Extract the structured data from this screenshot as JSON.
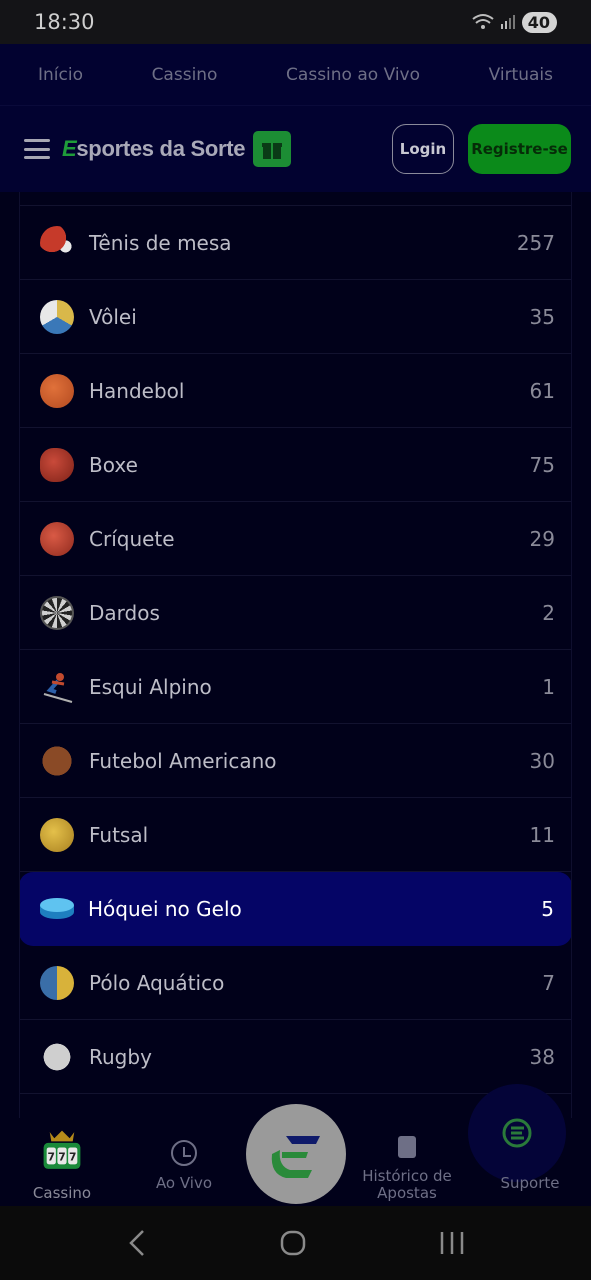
{
  "status_bar": {
    "time": "18:30",
    "battery": "40",
    "icons": [
      "wifi-icon",
      "signal-icon",
      "battery-icon"
    ]
  },
  "top_nav": {
    "items": [
      {
        "label": "Início"
      },
      {
        "label": "Cassino"
      },
      {
        "label": "Cassino ao Vivo"
      },
      {
        "label": "Virtuais"
      }
    ]
  },
  "header": {
    "logo_prefix": "E",
    "logo_text": "sportes da Sorte",
    "login_label": "Login",
    "register_label": "Registre-se"
  },
  "sports": [
    {
      "name": "Tênis de mesa",
      "count": "257",
      "icon": "table-tennis-icon"
    },
    {
      "name": "Vôlei",
      "count": "35",
      "icon": "volleyball-icon"
    },
    {
      "name": "Handebol",
      "count": "61",
      "icon": "handball-icon"
    },
    {
      "name": "Boxe",
      "count": "75",
      "icon": "boxing-glove-icon"
    },
    {
      "name": "Críquete",
      "count": "29",
      "icon": "cricket-ball-icon"
    },
    {
      "name": "Dardos",
      "count": "2",
      "icon": "dartboard-icon"
    },
    {
      "name": "Esqui Alpino",
      "count": "1",
      "icon": "skier-icon"
    },
    {
      "name": "Futebol Americano",
      "count": "30",
      "icon": "american-football-icon"
    },
    {
      "name": "Futsal",
      "count": "11",
      "icon": "futsal-ball-icon"
    },
    {
      "name": "Hóquei no Gelo",
      "count": "5",
      "icon": "hockey-puck-icon",
      "selected": true
    },
    {
      "name": "Pólo Aquático",
      "count": "7",
      "icon": "water-polo-ball-icon"
    },
    {
      "name": "Rugby",
      "count": "38",
      "icon": "rugby-ball-icon"
    }
  ],
  "bottom_nav": {
    "cassino": "Cassino",
    "ao_vivo": "Ao Vivo",
    "historico": "Histórico de Apostas",
    "suporte": "Suporte"
  },
  "colors": {
    "background": "#01011a",
    "accent_green": "#0b8a1a",
    "selected_row": "#050566"
  }
}
